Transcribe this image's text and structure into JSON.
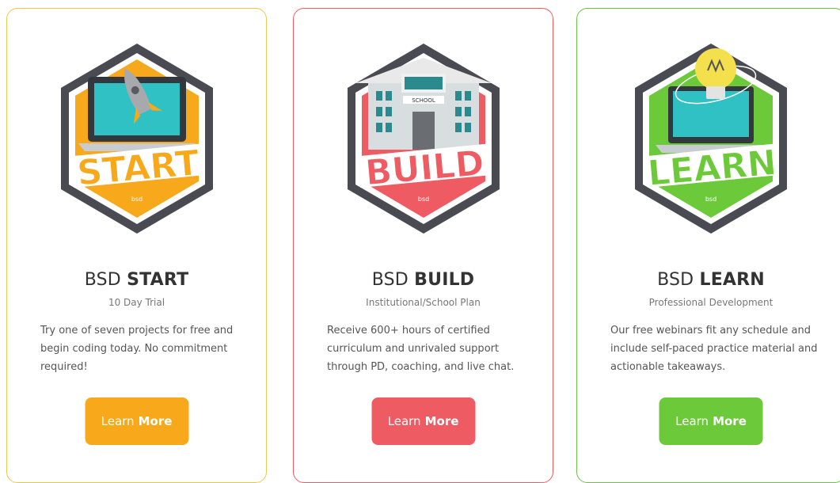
{
  "cards": [
    {
      "id": "start",
      "badge_text": "START",
      "brand_mark": "bsd",
      "title_prefix": "BSD",
      "title_strong": "START",
      "subtitle": "10 Day Trial",
      "description": "Try one of seven projects for free and begin coding today. No commitment required!",
      "button_prefix": "Learn",
      "button_strong": "More",
      "accent": "#f7a81b",
      "icon": "rocket-laptop-icon"
    },
    {
      "id": "build",
      "badge_text": "BUILD",
      "brand_mark": "bsd",
      "school_sign": "SCHOOL",
      "title_prefix": "BSD",
      "title_strong": "BUILD",
      "subtitle": "Institutional/School Plan",
      "description": "Receive 600+ hours of certified curriculum and unrivaled support through PD, coaching, and live chat.",
      "button_prefix": "Learn",
      "button_strong": "More",
      "accent": "#ef5b63",
      "icon": "school-building-icon"
    },
    {
      "id": "learn",
      "badge_text": "LEARN",
      "brand_mark": "bsd",
      "title_prefix": "BSD",
      "title_strong": "LEARN",
      "subtitle": "Professional Development",
      "description": "Our free webinars fit any schedule and include self-paced practice material and actionable takeaways.",
      "button_prefix": "Learn",
      "button_strong": "More",
      "accent": "#6cc93a",
      "icon": "lightbulb-laptop-icon"
    }
  ]
}
